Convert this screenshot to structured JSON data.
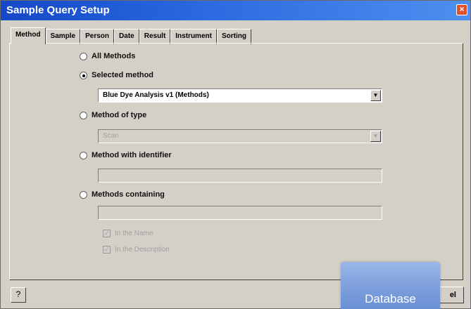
{
  "window": {
    "title": "Sample Query Setup",
    "close_glyph": "×"
  },
  "tabs": [
    {
      "label": "Method",
      "active": true
    },
    {
      "label": "Sample"
    },
    {
      "label": "Person"
    },
    {
      "label": "Date"
    },
    {
      "label": "Result"
    },
    {
      "label": "Instrument"
    },
    {
      "label": "Sorting"
    }
  ],
  "options": {
    "all_methods": "All Methods",
    "selected_method": "Selected method",
    "method_of_type": "Method of type",
    "method_with_identifier": "Method with identifier",
    "methods_containing": "Methods containing"
  },
  "fields": {
    "selected_method_value": "Blue Dye Analysis v1 (Methods)",
    "method_type_value": "Scan",
    "identifier_value": "",
    "containing_value": ""
  },
  "checkboxes": {
    "in_name": "In the Name",
    "in_description": "In the Description"
  },
  "footer": {
    "help_glyph": "?",
    "button_fragment": "el"
  },
  "overlay": {
    "badge_text": "Database"
  },
  "colors": {
    "titlebar": "#2c6be0",
    "window_bg": "#d4d0c8",
    "badge": "#7d9fdc"
  }
}
